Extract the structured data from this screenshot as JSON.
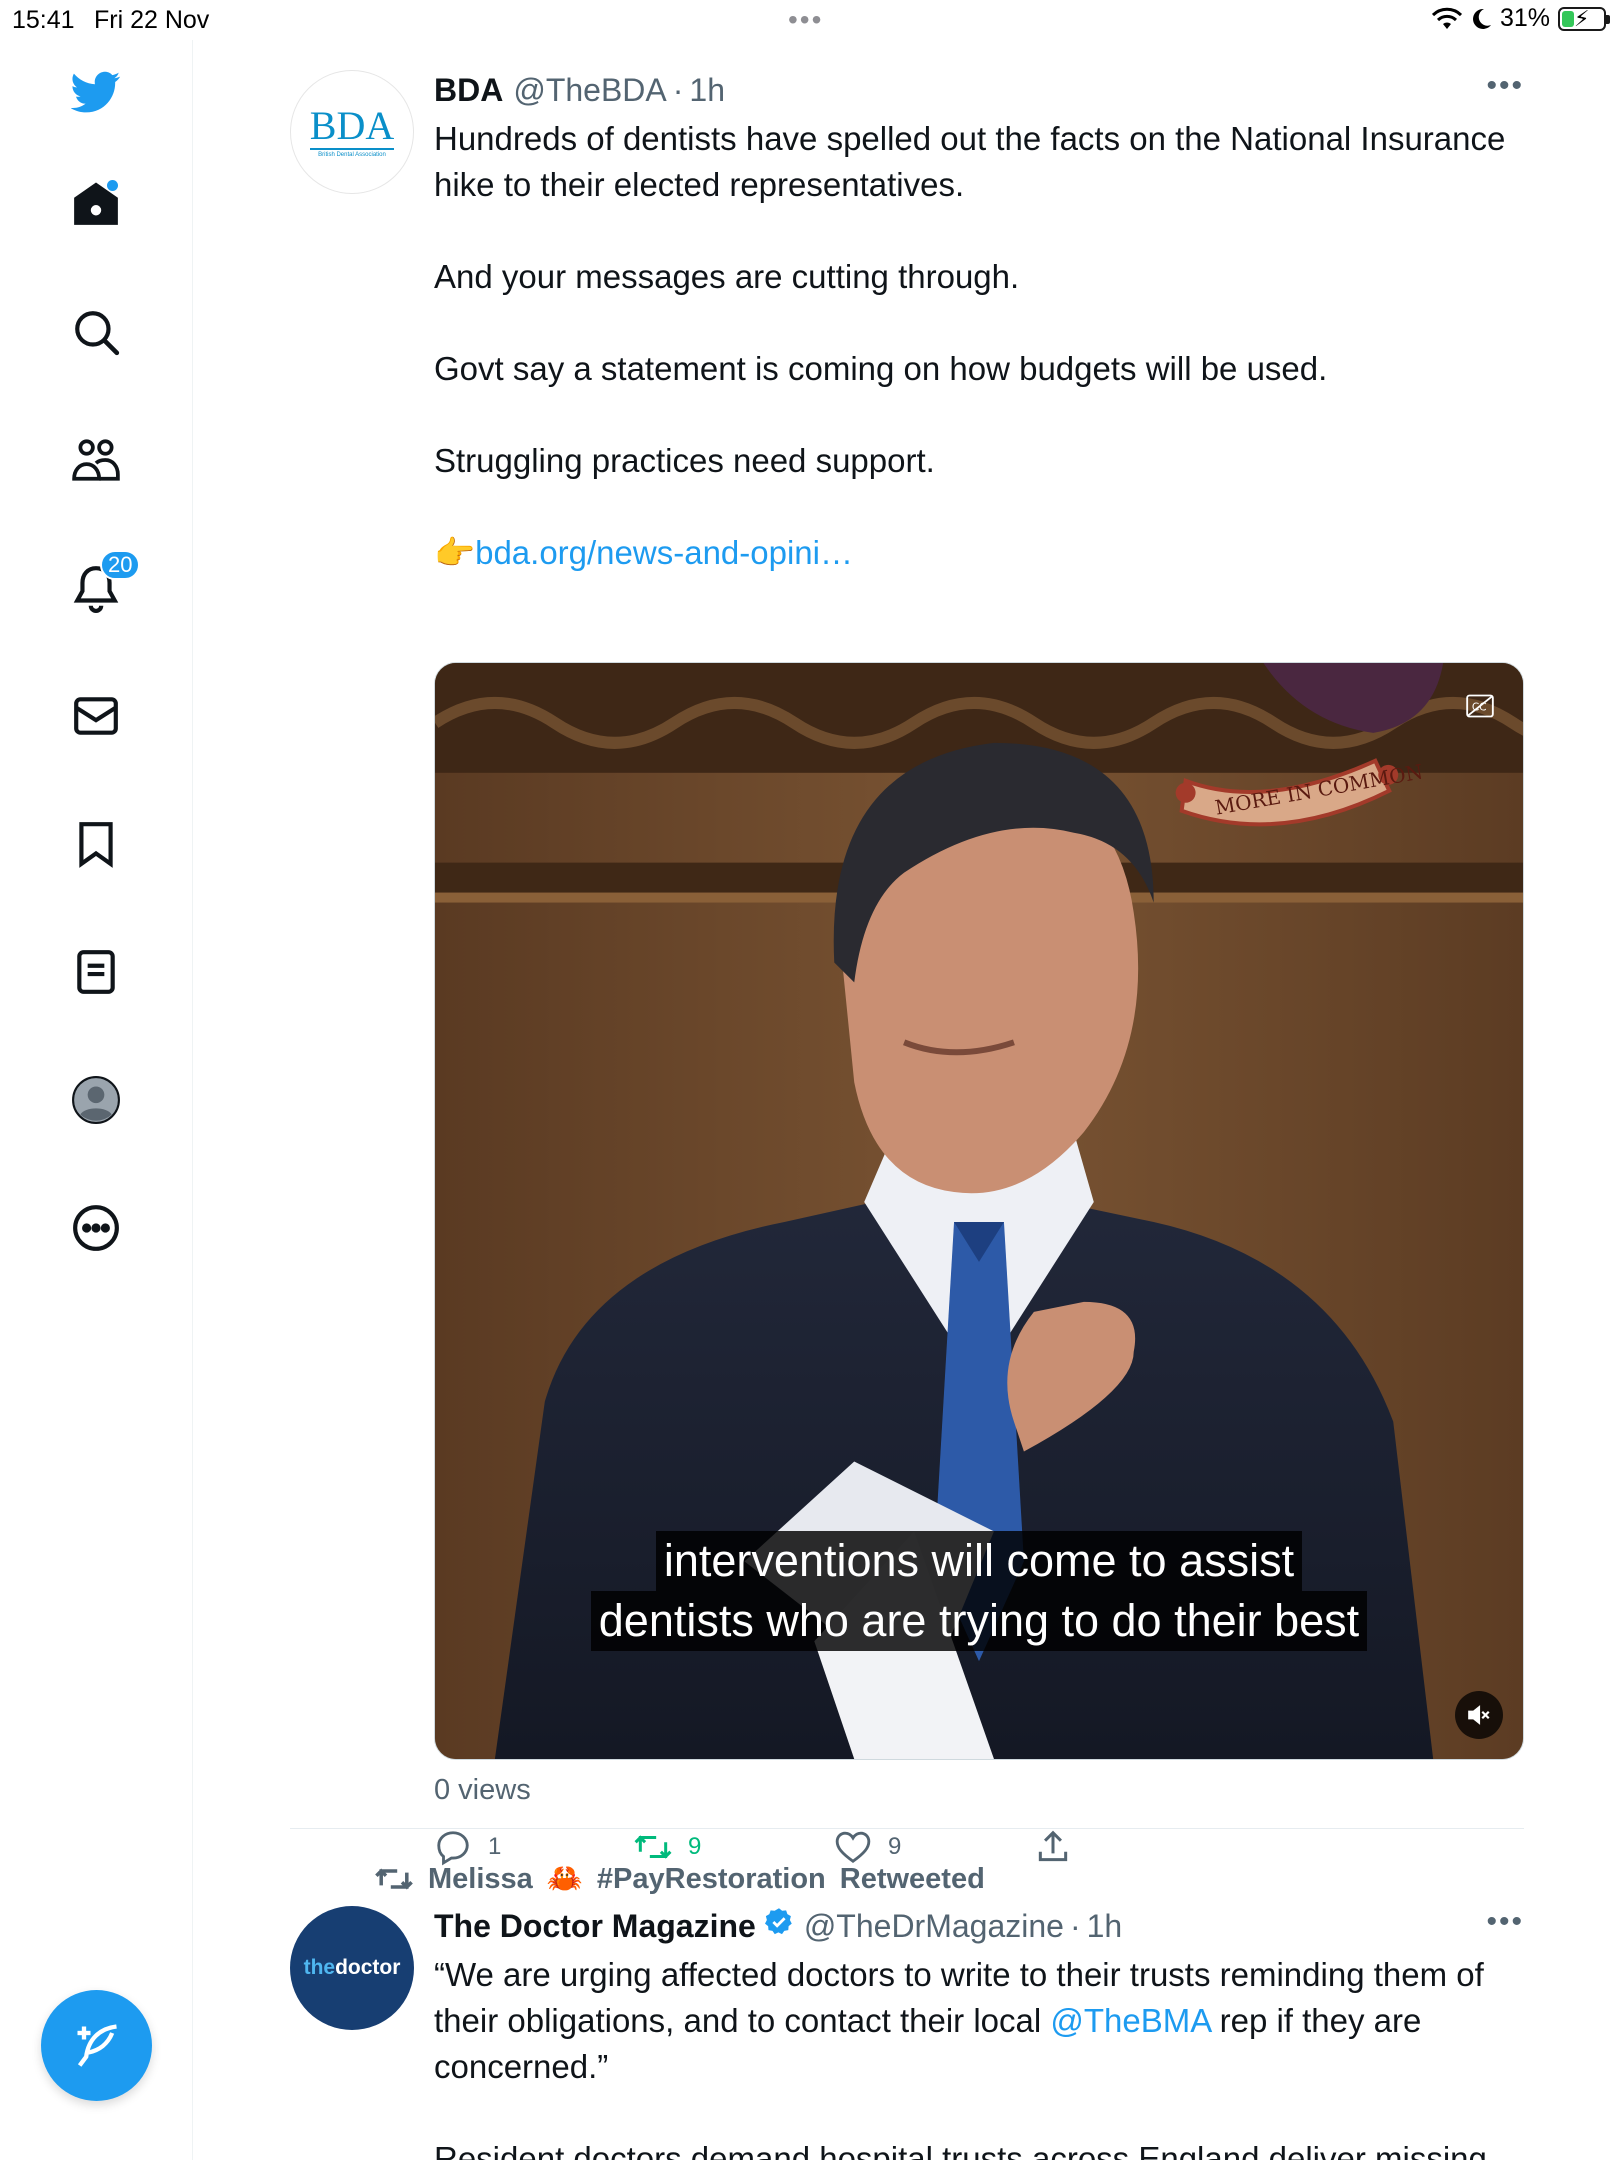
{
  "status_bar": {
    "time": "15:41",
    "date": "Fri 22 Nov",
    "battery": "31%",
    "battery_level": 0.31,
    "icons": [
      "wifi-icon",
      "moon-icon",
      "battery-charging-icon"
    ]
  },
  "sidebar": {
    "items": [
      {
        "name": "twitter-logo",
        "icon": "twitter-bird-icon"
      },
      {
        "name": "home",
        "icon": "home-icon"
      },
      {
        "name": "explore",
        "icon": "search-icon"
      },
      {
        "name": "communities",
        "icon": "communities-icon"
      },
      {
        "name": "notifications",
        "icon": "bell-icon",
        "badge": "20"
      },
      {
        "name": "messages",
        "icon": "mail-icon"
      },
      {
        "name": "bookmarks",
        "icon": "bookmark-icon"
      },
      {
        "name": "lists",
        "icon": "lists-icon"
      },
      {
        "name": "profile",
        "icon": "avatar-icon"
      },
      {
        "name": "more",
        "icon": "more-circle-icon"
      }
    ],
    "compose_icon": "compose-feather-icon"
  },
  "tweet1": {
    "name": "BDA",
    "handle": "@TheBDA",
    "sep": "·",
    "time": "1h",
    "avatar": {
      "logo_text": "BDA",
      "sub_text": "British Dental Association"
    },
    "paragraphs": [
      "Hundreds of dentists have spelled out the facts on the National Insurance hike to their elected representatives.",
      "And your messages are cutting through.",
      "Govt say a statement is coming on how budgets will be used.",
      "Struggling practices need support."
    ],
    "link_emoji": "👉",
    "link_text": "bda.org/news-and-opini…",
    "media": {
      "banner_text": "MORE IN COMMON",
      "caption_line1": "interventions will come to assist",
      "caption_line2": "dentists who are trying to do their best"
    },
    "views": "0 views",
    "actions": {
      "reply": "1",
      "retweet": "9",
      "like": "9"
    }
  },
  "retweet_context": {
    "user": "Melissa",
    "emoji": "🦀",
    "hashtag": "#PayRestoration",
    "label": "Retweeted"
  },
  "tweet2": {
    "name": "The Doctor Magazine",
    "handle": "@TheDrMagazine",
    "sep": "·",
    "time": "1h",
    "avatar": {
      "the": "the",
      "doctor": "doctor"
    },
    "text_before_mention": "“We are urging affected doctors to write to their trusts reminding them of their obligations, and to contact their local ",
    "mention": "@TheBMA",
    "text_after_mention": " rep if they are concerned.”",
    "next_paragraph": "Resident doctors demand hospital trusts across England deliver missing"
  },
  "colors": {
    "accent": "#1d9bf0",
    "retweet_green": "#00ba7c",
    "secondary_text": "#536471",
    "primary_text": "#0f1419"
  }
}
